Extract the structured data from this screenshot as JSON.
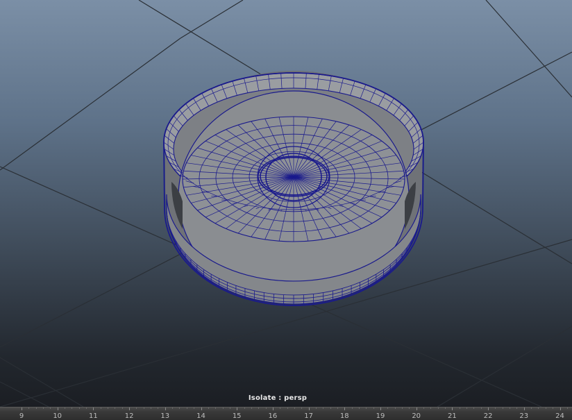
{
  "viewport": {
    "camera_label": "Isolate : persp",
    "object": "lid-mesh",
    "wireframe_color": "#1a1a8c",
    "shaded_color": "#8a8d91"
  },
  "timeline": {
    "frames": [
      "9",
      "10",
      "11",
      "12",
      "13",
      "14",
      "15",
      "16",
      "17",
      "18",
      "19",
      "20",
      "21",
      "22",
      "23",
      "24"
    ]
  }
}
